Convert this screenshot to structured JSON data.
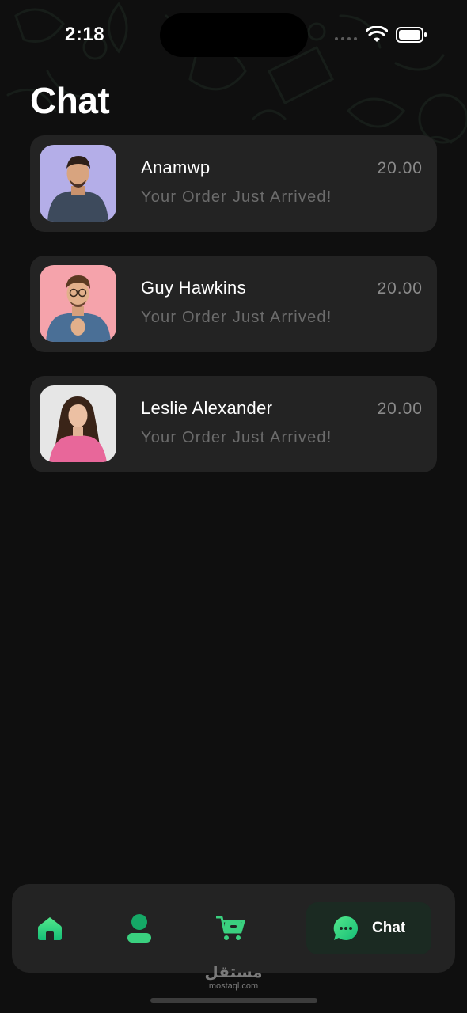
{
  "status_bar": {
    "time": "2:18"
  },
  "page": {
    "title": "Chat"
  },
  "chats": [
    {
      "name": "Anamwp",
      "amount": "20.00",
      "message": "Your Order Just Arrived!"
    },
    {
      "name": "Guy Hawkins",
      "amount": "20.00",
      "message": "Your Order Just Arrived!"
    },
    {
      "name": "Leslie Alexander",
      "amount": "20.00",
      "message": "Your Order Just Arrived!"
    }
  ],
  "bottom_nav": {
    "items": [
      {
        "icon": "home-icon"
      },
      {
        "icon": "profile-icon"
      },
      {
        "icon": "cart-icon"
      },
      {
        "icon": "chat-bubble-icon",
        "label": "Chat",
        "active": true
      }
    ]
  },
  "watermark": {
    "arabic": "مستقل",
    "latin": "mostaql.com"
  },
  "colors": {
    "accent": "#2ecc71",
    "card": "#232323",
    "background": "#0f0f0f",
    "muted_text": "#6b6b6b"
  }
}
